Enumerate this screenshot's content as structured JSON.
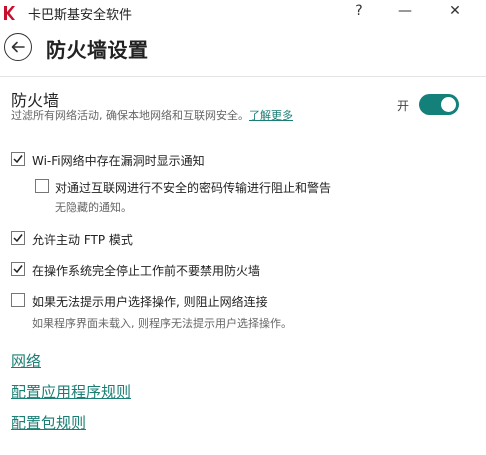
{
  "window": {
    "title": "卡巴斯基安全软件",
    "help_glyph": "?",
    "minimize_glyph": "—",
    "close_glyph": "✕"
  },
  "header": {
    "title": "防火墙设置"
  },
  "firewall": {
    "title": "防火墙",
    "description": "过滤所有网络活动, 确保本地网络和互联网安全。",
    "learn_more": "了解更多",
    "toggle_label": "开",
    "enabled": true
  },
  "options": [
    {
      "label": "Wi-Fi网络中存在漏洞时显示通知",
      "checked": true
    },
    {
      "label": "对通过互联网进行不安全的密码传输进行阻止和警告",
      "checked": false,
      "sub": "无隐藏的通知。"
    },
    {
      "label": "允许主动 FTP 模式",
      "checked": true
    },
    {
      "label": "在操作系统完全停止工作前不要禁用防火墙",
      "checked": true
    },
    {
      "label": "如果无法提示用户选择操作, 则阻止网络连接",
      "checked": false,
      "sub": "如果程序界面未载入, 则程序无法提示用户选择操作。"
    }
  ],
  "links": {
    "network": "网络",
    "app_rules": "配置应用程序规则",
    "packet_rules": "配置包规则"
  },
  "colors": {
    "accent": "#13807a",
    "link": "#1a7e74",
    "logo_red": "#c8102e"
  },
  "icons": {
    "logo": "kaspersky-k-icon",
    "back": "back-arrow-icon",
    "check": "check-icon"
  }
}
